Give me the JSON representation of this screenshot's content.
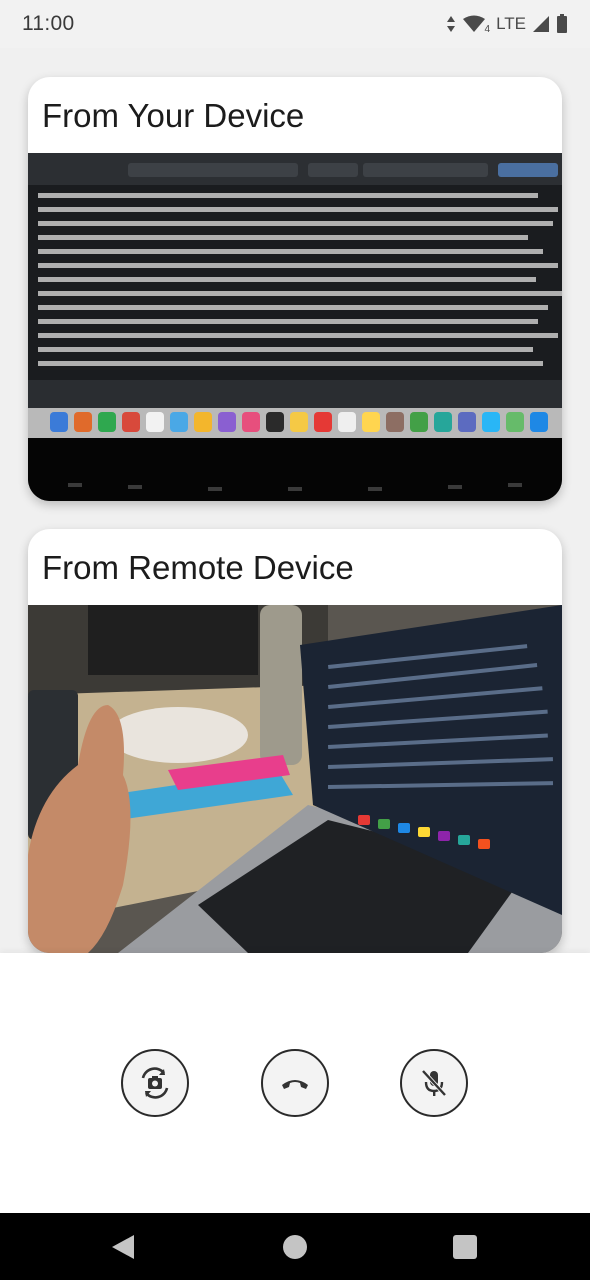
{
  "status_bar": {
    "time": "11:00",
    "network_label": "LTE",
    "wifi_badge": "4"
  },
  "local_card": {
    "title": "From Your Device"
  },
  "remote_card": {
    "title": "From Remote Device"
  },
  "controls": {
    "switch_camera_icon": "camera-switch-icon",
    "end_call_icon": "phone-hangup-icon",
    "mute_icon": "mic-off-icon"
  },
  "nav": {
    "back_icon": "back-triangle-icon",
    "home_icon": "home-circle-icon",
    "recents_icon": "recents-square-icon"
  },
  "colors": {
    "background": "#f0f0f0",
    "card": "#ffffff",
    "button_border": "#2a2a2a",
    "nav_bar": "#000000"
  }
}
